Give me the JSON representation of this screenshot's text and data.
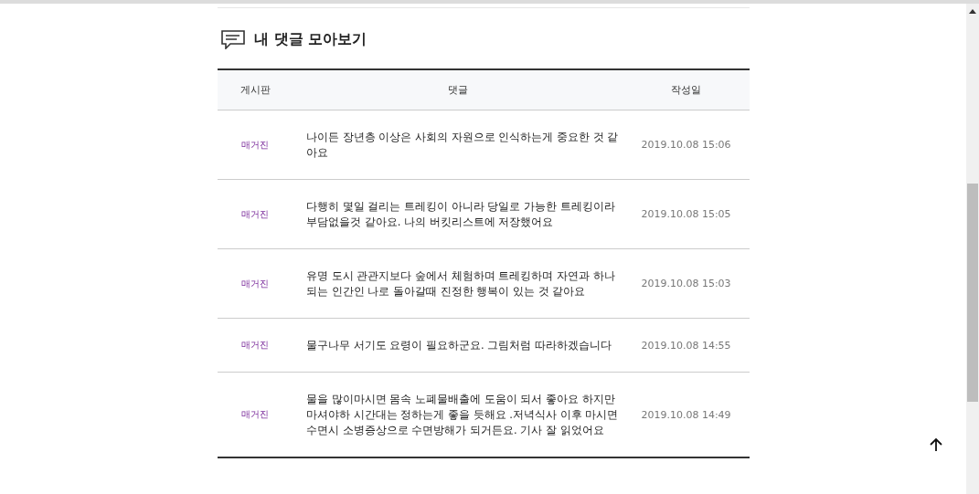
{
  "section": {
    "title": "내 댓글 모아보기"
  },
  "table": {
    "columns": [
      "게시판",
      "댓글",
      "작성일"
    ],
    "rows": [
      {
        "board": "매거진",
        "comment": "나이든 장년층 이상은 사회의 자원으로 인식하는게 중요한 것 같아요",
        "date": "2019.10.08 15:06"
      },
      {
        "board": "매거진",
        "comment": "다행히 몇일 걸리는 트레킹이 아니라 당일로 가능한 트레킹이라 부담없을것 같아요. 나의 버킷리스트에 저장했어요",
        "date": "2019.10.08 15:05"
      },
      {
        "board": "매거진",
        "comment": "유명 도시 관관지보다 숲에서 체험하며 트레킹하며 자연과 하나되는 인간인 나로 돌아갈때 진정한 행복이 있는 것 같아요",
        "date": "2019.10.08 15:03"
      },
      {
        "board": "매거진",
        "comment": "물구나무 서기도 요령이 필요하군요. 그림처럼 따라하겠습니다",
        "date": "2019.10.08 14:55"
      },
      {
        "board": "매거진",
        "comment": "물을 많이마시면 몸속 노폐물배출에 도움이 되서 좋아요 하지만 마셔야하 시간대는 정하는게 좋을 듯해요 .저녁식사 이후 마시면 수면시 소병증상으로 수면방해가 되거든요. 기사 잘 읽었어요",
        "date": "2019.10.08 14:49"
      }
    ]
  }
}
